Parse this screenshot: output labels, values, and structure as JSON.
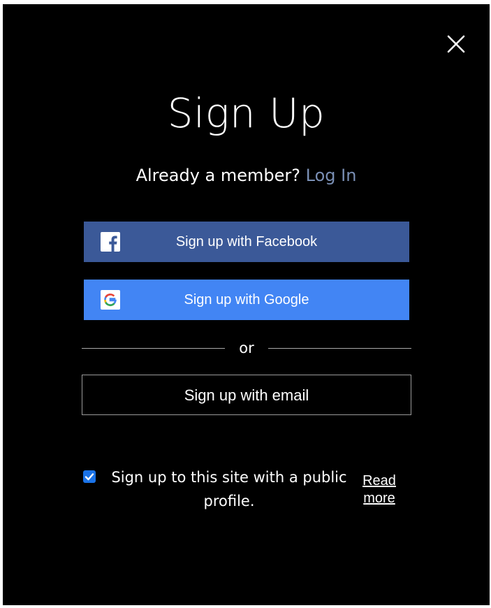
{
  "dialog": {
    "close_icon": "close-icon",
    "title": "Sign Up",
    "member_prompt": "Already a member?",
    "login_link": "Log In",
    "facebook_button": {
      "label": "Sign up with Facebook",
      "icon": "facebook-icon",
      "color": "#3b5998"
    },
    "google_button": {
      "label": "Sign up with Google",
      "icon": "google-icon",
      "color": "#4285f4"
    },
    "divider_text": "or",
    "email_button": "Sign up with email",
    "public_profile": {
      "checked": true,
      "label": "Sign up to this site with a public profile.",
      "read_more": "Read more"
    }
  }
}
